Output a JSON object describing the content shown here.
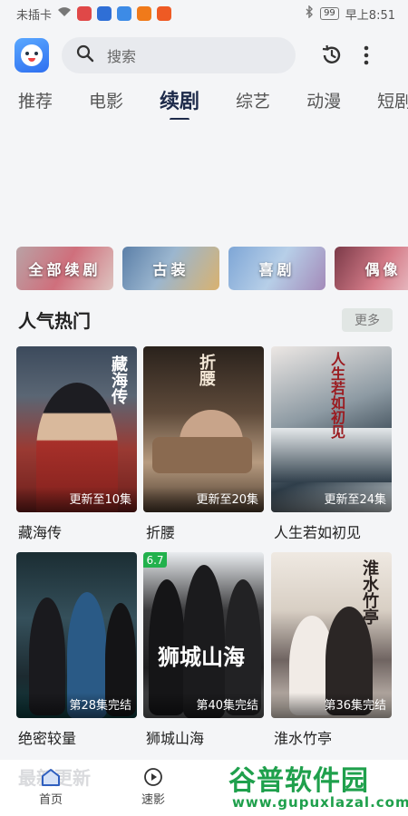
{
  "status_bar": {
    "carrier": "未插卡",
    "battery": "99",
    "time": "早上8:51"
  },
  "header": {
    "search_placeholder": "搜索"
  },
  "tabs": [
    {
      "label": "推荐"
    },
    {
      "label": "电影"
    },
    {
      "label": "续剧",
      "active": true
    },
    {
      "label": "综艺"
    },
    {
      "label": "动漫"
    },
    {
      "label": "短剧"
    }
  ],
  "categories": [
    {
      "label": "全部续剧"
    },
    {
      "label": "古装"
    },
    {
      "label": "喜剧"
    },
    {
      "label": "偶像"
    }
  ],
  "section": {
    "title": "人气热门",
    "more": "更多"
  },
  "posters": [
    {
      "title": "藏海传",
      "update": "更新至10集",
      "poster_text": "藏海传"
    },
    {
      "title": "折腰",
      "update": "更新至20集",
      "poster_text": "折腰"
    },
    {
      "title": "人生若如初见",
      "update": "更新至24集",
      "poster_text": "人生若如初见"
    },
    {
      "title": "绝密较量",
      "update": "第28集完结"
    },
    {
      "title": "狮城山海",
      "update": "第40集完结",
      "score": "6.7",
      "poster_text": "狮城山海"
    },
    {
      "title": "淮水竹亭",
      "update": "第36集完结",
      "poster_text": "淮水竹亭"
    }
  ],
  "next_section": {
    "title": "最新更新"
  },
  "bottom_nav": [
    {
      "label": "首页",
      "icon": "home-icon",
      "active": true
    },
    {
      "label": "速影",
      "icon": "play-circle-icon"
    }
  ],
  "watermark": {
    "name": "谷普软件园",
    "url": "www.gupuxlazal.com"
  },
  "colors": {
    "accent": "#1d2a4a",
    "watermark_green": "#1fa04c",
    "score_badge": "#22b14c"
  }
}
